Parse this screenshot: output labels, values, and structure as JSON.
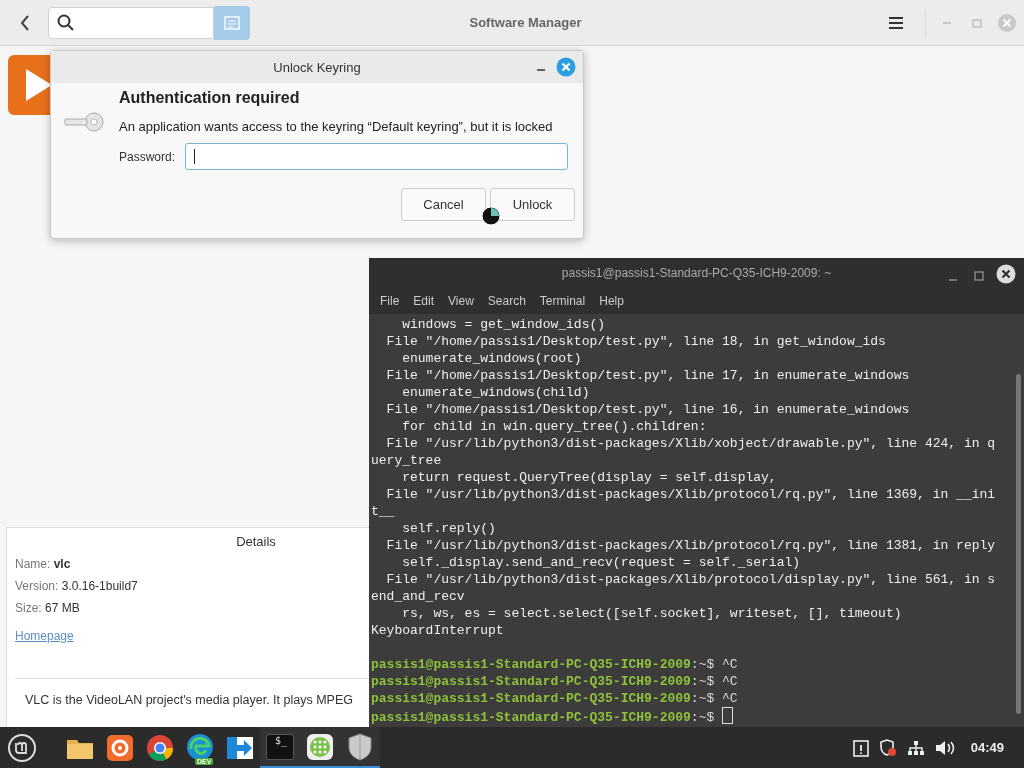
{
  "main_window": {
    "title": "Software Manager",
    "details": {
      "heading": "Details",
      "fields": [
        {
          "label": "Name:",
          "value": "vlc",
          "bold": true
        },
        {
          "label": "Version:",
          "value": "3.0.16-1build7",
          "bold": false
        },
        {
          "label": "Size:",
          "value": "67 MB",
          "bold": false
        }
      ],
      "link": "Homepage"
    },
    "description": "VLC is the VideoLAN project's media player. It plays MPEG"
  },
  "dialog": {
    "title": "Unlock Keyring",
    "heading": "Authentication required",
    "message": "An application wants access to the keyring “Default keyring”, but it is locked",
    "password_label": "Password:",
    "buttons": [
      "Cancel",
      "Unlock"
    ]
  },
  "terminal": {
    "title": "passis1@passis1-Standard-PC-Q35-ICH9-2009: ~",
    "menu": [
      "File",
      "Edit",
      "View",
      "Search",
      "Terminal",
      "Help"
    ],
    "lines": [
      {
        "kind": "output",
        "text": "    windows = get_window_ids()"
      },
      {
        "kind": "output",
        "text": "  File \"/home/passis1/Desktop/test.py\", line 18, in get_window_ids"
      },
      {
        "kind": "output",
        "text": "    enumerate_windows(root)"
      },
      {
        "kind": "output",
        "text": "  File \"/home/passis1/Desktop/test.py\", line 17, in enumerate_windows"
      },
      {
        "kind": "output",
        "text": "    enumerate_windows(child)"
      },
      {
        "kind": "output",
        "text": "  File \"/home/passis1/Desktop/test.py\", line 16, in enumerate_windows"
      },
      {
        "kind": "output",
        "text": "    for child in win.query_tree().children:"
      },
      {
        "kind": "output",
        "text": "  File \"/usr/lib/python3/dist-packages/Xlib/xobject/drawable.py\", line 424, in q"
      },
      {
        "kind": "output",
        "text": "uery_tree"
      },
      {
        "kind": "output",
        "text": "    return request.QueryTree(display = self.display,"
      },
      {
        "kind": "output",
        "text": "  File \"/usr/lib/python3/dist-packages/Xlib/protocol/rq.py\", line 1369, in __ini"
      },
      {
        "kind": "output",
        "text": "t__"
      },
      {
        "kind": "output",
        "text": "    self.reply()"
      },
      {
        "kind": "output",
        "text": "  File \"/usr/lib/python3/dist-packages/Xlib/protocol/rq.py\", line 1381, in reply"
      },
      {
        "kind": "output",
        "text": "    self._display.send_and_recv(request = self._serial)"
      },
      {
        "kind": "output",
        "text": "  File \"/usr/lib/python3/dist-packages/Xlib/protocol/display.py\", line 561, in s"
      },
      {
        "kind": "output",
        "text": "end_and_recv"
      },
      {
        "kind": "output",
        "text": "    rs, ws, es = select.select([self.socket], writeset, [], timeout)"
      },
      {
        "kind": "output",
        "text": "KeyboardInterrupt"
      },
      {
        "kind": "blank"
      },
      {
        "kind": "prompt",
        "host": "passis1@passis1-Standard-PC-Q35-ICH9-2009",
        "rest": ":~$ ^C"
      },
      {
        "kind": "prompt",
        "host": "passis1@passis1-Standard-PC-Q35-ICH9-2009",
        "rest": ":~$ ^C"
      },
      {
        "kind": "prompt",
        "host": "passis1@passis1-Standard-PC-Q35-ICH9-2009",
        "rest": ":~$ ^C"
      },
      {
        "kind": "prompt",
        "host": "passis1@passis1-Standard-PC-Q35-ICH9-2009",
        "rest": ":~$ ",
        "cursor": true
      }
    ]
  },
  "taskbar": {
    "apps": [
      {
        "kind": "files",
        "active": false
      },
      {
        "kind": "firefox",
        "active": false
      },
      {
        "kind": "chrome",
        "active": false
      },
      {
        "kind": "edge",
        "badge": "DEV",
        "active": false
      },
      {
        "kind": "remote",
        "active": false
      },
      {
        "kind": "terminal",
        "glyph": "$_",
        "active": true
      },
      {
        "kind": "grid",
        "active": true
      },
      {
        "kind": "shield",
        "active": true
      }
    ],
    "clock": "04:49"
  }
}
